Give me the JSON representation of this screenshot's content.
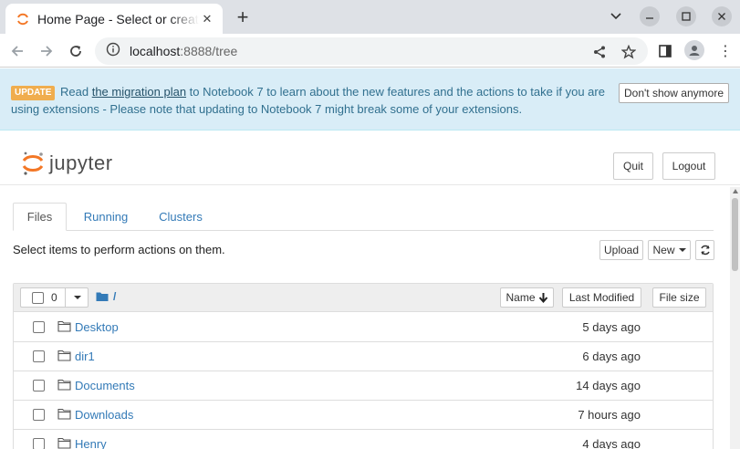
{
  "browser": {
    "tab_title": "Home Page - Select or create a notebook",
    "url_host": "localhost",
    "url_rest": ":8888/tree"
  },
  "banner": {
    "badge": "UPDATE",
    "text_before": "Read ",
    "link": "the migration plan",
    "text_after": " to Notebook 7 to learn about the new features and the actions to take if you are using extensions - Please note that updating to Notebook 7 might break some of your extensions.",
    "dismiss": "Don't show anymore",
    "color": "#d9edf7"
  },
  "header": {
    "logo_word": "jupyter",
    "quit": "Quit",
    "logout": "Logout"
  },
  "tabs": [
    "Files",
    "Running",
    "Clusters"
  ],
  "toolbar": {
    "hint": "Select items to perform actions on them.",
    "upload": "Upload",
    "new": "New"
  },
  "list": {
    "selected_count": "0",
    "breadcrumb": "/",
    "sort_name": "Name",
    "sort_modified": "Last Modified",
    "sort_size": "File size",
    "rows": [
      {
        "name": "Desktop",
        "modified": "5 days ago"
      },
      {
        "name": "dir1",
        "modified": "6 days ago"
      },
      {
        "name": "Documents",
        "modified": "14 days ago"
      },
      {
        "name": "Downloads",
        "modified": "7 hours ago"
      },
      {
        "name": "Henry",
        "modified": "4 days ago"
      }
    ]
  },
  "colors": {
    "link": "#337ab7",
    "accent": "#f37726"
  }
}
